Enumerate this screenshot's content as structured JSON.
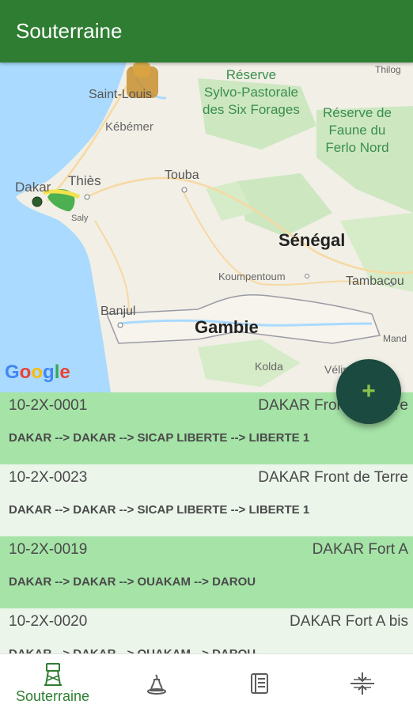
{
  "appbar": {
    "title": "Souterraine"
  },
  "map": {
    "labels": {
      "saint_louis": "Saint-Louis",
      "reserve_sylvo": "Réserve\nSylvo-Pastorale\ndes Six Forages",
      "reserve_faune": "Réserve de\nFaune du\nFerlo Nord",
      "kebemer": "Kébémer",
      "thies": "Thiès",
      "dakar": "Dakar",
      "touba": "Touba",
      "saly": "Saly",
      "senegal": "Sénégal",
      "koumpentoum": "Koumpentoum",
      "tambacounda": "Tambacou",
      "banjul": "Banjul",
      "gambie": "Gambie",
      "kolda": "Kolda",
      "velingara": "Vélin",
      "mandat": "Mand",
      "thilogne": "Thilog"
    },
    "google_logo": {
      "letters": [
        "G",
        "o",
        "o",
        "g",
        "l",
        "e"
      ],
      "colors": [
        "#4285F4",
        "#EA4335",
        "#FBBC05",
        "#4285F4",
        "#34A853",
        "#EA4335"
      ]
    }
  },
  "fab": {
    "icon": "add-icon",
    "glyph": "+"
  },
  "wells": [
    {
      "code": "10-2X-0001",
      "place": "DAKAR Front de Terre",
      "path": "DAKAR --> DAKAR --> SICAP LIBERTE --> LIBERTE 1",
      "highlighted": true
    },
    {
      "code": "10-2X-0023",
      "place": "DAKAR Front de Terre",
      "path": "DAKAR --> DAKAR --> SICAP LIBERTE --> LIBERTE 1",
      "highlighted": false
    },
    {
      "code": "10-2X-0019",
      "place": "DAKAR Fort A",
      "path": "DAKAR --> DAKAR --> OUAKAM --> DAROU",
      "highlighted": true
    },
    {
      "code": "10-2X-0020",
      "place": "DAKAR Fort A bis",
      "path": "DAKAR --> DAKAR --> OUAKAM --> DAROU",
      "highlighted": false
    }
  ],
  "bottom_nav": [
    {
      "label": "Souterraine",
      "icon": "water-tower-icon",
      "active": true
    },
    {
      "label": "",
      "icon": "well-icon",
      "active": false
    },
    {
      "label": "",
      "icon": "ledger-icon",
      "active": false
    },
    {
      "label": "",
      "icon": "compress-icon",
      "active": false
    }
  ],
  "colors": {
    "primary": "#2e7d32",
    "row_highlight": "#a5e3a7",
    "row_plain": "#ebf5ea",
    "fab": "#1b4a40",
    "fab_icon": "#8bc34a"
  }
}
